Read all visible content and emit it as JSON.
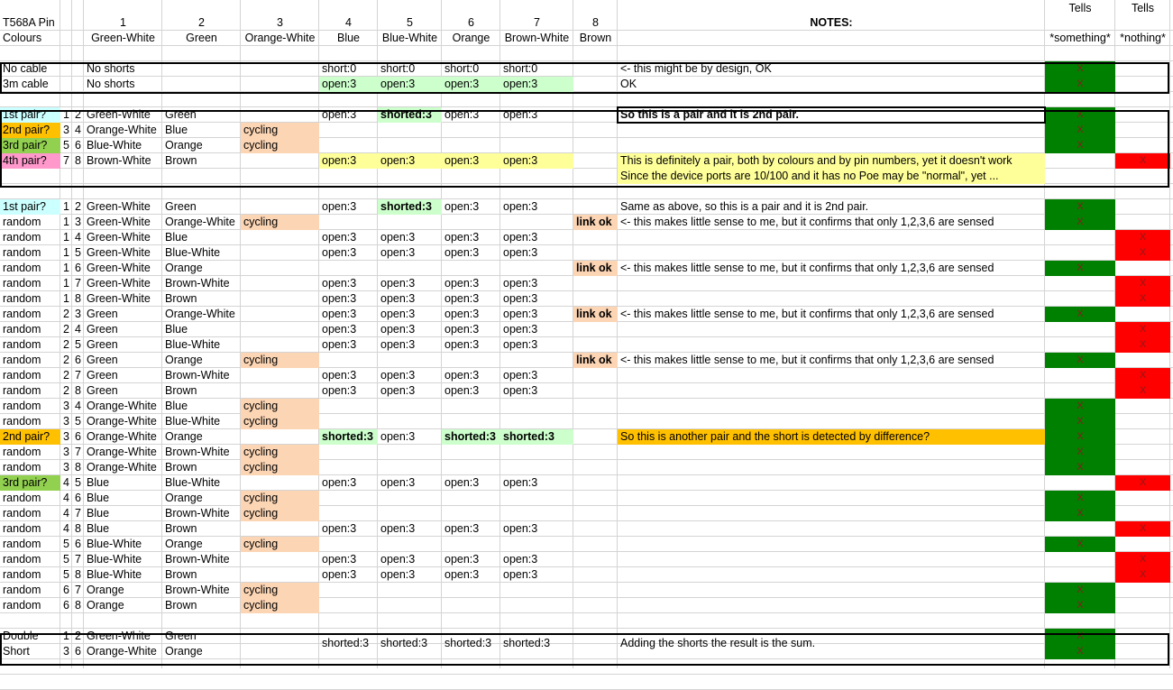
{
  "colors": {
    "light_blue": "#ccffff",
    "orange": "#ffc000",
    "green_yellow": "#92d050",
    "pink": "#ff99cc",
    "peach": "#fcd5b4",
    "light_green": "#ccffcc",
    "light_yellow": "#ffff99",
    "dark_green": "#008000",
    "red": "#ff0000",
    "grid": "#d4d4d4"
  },
  "header": {
    "row1": {
      "a": "T568A Pin",
      "d": "1",
      "e": "2",
      "f": "3",
      "g": "4",
      "h": "5",
      "i": "6",
      "j": "7",
      "k": "8",
      "l": "NOTES:",
      "m": "Tells",
      "n": "Tells"
    },
    "row2": {
      "a": "Colours",
      "d": "Green-White",
      "e": "Green",
      "f": "Orange-White",
      "g": "Blue",
      "h": "Blue-White",
      "i": "Orange",
      "j": "Brown-White",
      "k": "Brown",
      "m": "*something*",
      "n": "*nothing*"
    }
  },
  "rows": [
    {
      "r": 4,
      "a": "No cable",
      "d": "No shorts",
      "g": "short:0",
      "h": "short:0",
      "i": "short:0",
      "j": "short:0",
      "l": "<- this might be by design, OK",
      "m": "X",
      "mfill": "dark_green"
    },
    {
      "r": 5,
      "a": "3m cable",
      "d": "No shorts",
      "g": "open:3",
      "h": "open:3",
      "i": "open:3",
      "j": "open:3",
      "gfill": "light_green",
      "hfill": "light_green",
      "ifill": "light_green",
      "jfill": "light_green",
      "l": "OK",
      "m": "X",
      "mfill": "dark_green"
    },
    {
      "r": 7,
      "a": "1st pair?",
      "afill": "light_blue",
      "b": "1",
      "c": "2",
      "d": "Green-White",
      "e": "Green",
      "g": "open:3",
      "h": "shorted:3",
      "hbold": true,
      "hfill": "light_green",
      "i": "open:3",
      "j": "open:3",
      "l": "So this is a pair and it is 2nd pair.",
      "lbold": true,
      "m": "X",
      "mfill": "dark_green"
    },
    {
      "r": 8,
      "a": "2nd pair?",
      "afill": "orange",
      "b": "3",
      "c": "4",
      "d": "Orange-White",
      "e": "Blue",
      "f": "cycling",
      "ffill": "peach",
      "m": "X",
      "mfill": "dark_green"
    },
    {
      "r": 9,
      "a": "3rd pair?",
      "afill": "green_yellow",
      "b": "5",
      "c": "6",
      "d": "Blue-White",
      "e": "Orange",
      "f": "cycling",
      "ffill": "peach",
      "m": "X",
      "mfill": "dark_green"
    },
    {
      "r": 10,
      "a": "4th pair?",
      "afill": "pink",
      "b": "7",
      "c": "8",
      "d": "Brown-White",
      "e": "Brown",
      "g": "open:3",
      "h": "open:3",
      "i": "open:3",
      "j": "open:3",
      "gfill": "light_yellow",
      "hfill": "light_yellow",
      "ifill": "light_yellow",
      "jfill": "light_yellow",
      "l": "This is definitely a pair, both by colours and by pin numbers, yet it doesn't work",
      "lfill": "light_yellow",
      "n": "X",
      "nfill": "red"
    },
    {
      "r": 11,
      "l": "Since the device ports are 10/100 and it has no Poe may be \"normal\", yet ...",
      "lfill": "light_yellow"
    },
    {
      "r": 13,
      "a": "1st pair?",
      "afill": "light_blue",
      "b": "1",
      "c": "2",
      "d": "Green-White",
      "e": "Green",
      "g": "open:3",
      "h": "shorted:3",
      "hbold": true,
      "hfill": "light_green",
      "i": "open:3",
      "j": "open:3",
      "l": "Same as above, so this is a pair and it is 2nd pair.",
      "m": "X",
      "mfill": "dark_green"
    },
    {
      "r": 14,
      "a": "random",
      "b": "1",
      "c": "3",
      "d": "Green-White",
      "e": "Orange-White",
      "f": "cycling",
      "ffill": "peach",
      "k": "link ok",
      "kbold": true,
      "kfill": "peach",
      "l": "<- this makes little sense to me, but it confirms that only 1,2,3,6 are sensed",
      "m": "X",
      "mfill": "dark_green"
    },
    {
      "r": 15,
      "a": "random",
      "b": "1",
      "c": "4",
      "d": "Green-White",
      "e": "Blue",
      "g": "open:3",
      "h": "open:3",
      "i": "open:3",
      "j": "open:3",
      "n": "X",
      "nfill": "red"
    },
    {
      "r": 16,
      "a": "random",
      "b": "1",
      "c": "5",
      "d": "Green-White",
      "e": "Blue-White",
      "g": "open:3",
      "h": "open:3",
      "i": "open:3",
      "j": "open:3",
      "n": "X",
      "nfill": "red"
    },
    {
      "r": 17,
      "a": "random",
      "b": "1",
      "c": "6",
      "d": "Green-White",
      "e": "Orange",
      "k": "link ok",
      "kbold": true,
      "kfill": "peach",
      "l": "<- this makes little sense to me, but it confirms that only 1,2,3,6 are sensed",
      "m": "X",
      "mfill": "dark_green"
    },
    {
      "r": 18,
      "a": "random",
      "b": "1",
      "c": "7",
      "d": "Green-White",
      "e": "Brown-White",
      "g": "open:3",
      "h": "open:3",
      "i": "open:3",
      "j": "open:3",
      "n": "X",
      "nfill": "red"
    },
    {
      "r": 19,
      "a": "random",
      "b": "1",
      "c": "8",
      "d": "Green-White",
      "e": "Brown",
      "g": "open:3",
      "h": "open:3",
      "i": "open:3",
      "j": "open:3",
      "n": "X",
      "nfill": "red"
    },
    {
      "r": 20,
      "a": "random",
      "b": "2",
      "c": "3",
      "d": "Green",
      "e": "Orange-White",
      "g": "open:3",
      "h": "open:3",
      "i": "open:3",
      "j": "open:3",
      "k": "link ok",
      "kbold": true,
      "kfill": "peach",
      "l": "<- this makes little sense to me, but it confirms that only 1,2,3,6 are sensed",
      "m": "X",
      "mfill": "dark_green"
    },
    {
      "r": 21,
      "a": "random",
      "b": "2",
      "c": "4",
      "d": "Green",
      "e": "Blue",
      "g": "open:3",
      "h": "open:3",
      "i": "open:3",
      "j": "open:3",
      "n": "X",
      "nfill": "red"
    },
    {
      "r": 22,
      "a": "random",
      "b": "2",
      "c": "5",
      "d": "Green",
      "e": "Blue-White",
      "g": "open:3",
      "h": "open:3",
      "i": "open:3",
      "j": "open:3",
      "n": "X",
      "nfill": "red"
    },
    {
      "r": 23,
      "a": "random",
      "b": "2",
      "c": "6",
      "d": "Green",
      "e": "Orange",
      "f": "cycling",
      "ffill": "peach",
      "k": "link ok",
      "kbold": true,
      "kfill": "peach",
      "l": "<- this makes little sense to me, but it confirms that only 1,2,3,6 are sensed",
      "m": "X",
      "mfill": "dark_green"
    },
    {
      "r": 24,
      "a": "random",
      "b": "2",
      "c": "7",
      "d": "Green",
      "e": "Brown-White",
      "g": "open:3",
      "h": "open:3",
      "i": "open:3",
      "j": "open:3",
      "n": "X",
      "nfill": "red"
    },
    {
      "r": 25,
      "a": "random",
      "b": "2",
      "c": "8",
      "d": "Green",
      "e": "Brown",
      "g": "open:3",
      "h": "open:3",
      "i": "open:3",
      "j": "open:3",
      "n": "X",
      "nfill": "red"
    },
    {
      "r": 26,
      "a": "random",
      "b": "3",
      "c": "4",
      "d": "Orange-White",
      "e": "Blue",
      "f": "cycling",
      "ffill": "peach",
      "m": "X",
      "mfill": "dark_green"
    },
    {
      "r": 27,
      "a": "random",
      "b": "3",
      "c": "5",
      "d": "Orange-White",
      "e": "Blue-White",
      "f": "cycling",
      "ffill": "peach",
      "m": "X",
      "mfill": "dark_green"
    },
    {
      "r": 28,
      "a": "2nd pair?",
      "afill": "orange",
      "b": "3",
      "c": "6",
      "d": "Orange-White",
      "e": "Orange",
      "g": "shorted:3",
      "gbold": true,
      "gfill": "light_green",
      "h": "open:3",
      "i": "shorted:3",
      "ibold": true,
      "ifill": "light_green",
      "j": "shorted:3",
      "jbold": true,
      "jfill": "light_green",
      "l": "So this is another pair and the short is detected by difference?",
      "lfill": "orange",
      "m": "X",
      "mfill": "dark_green"
    },
    {
      "r": 29,
      "a": "random",
      "b": "3",
      "c": "7",
      "d": "Orange-White",
      "e": "Brown-White",
      "f": "cycling",
      "ffill": "peach",
      "m": "X",
      "mfill": "dark_green"
    },
    {
      "r": 30,
      "a": "random",
      "b": "3",
      "c": "8",
      "d": "Orange-White",
      "e": "Brown",
      "f": "cycling",
      "ffill": "peach",
      "m": "X",
      "mfill": "dark_green"
    },
    {
      "r": 31,
      "a": "3rd pair?",
      "afill": "green_yellow",
      "b": "4",
      "c": "5",
      "d": "Blue",
      "e": "Blue-White",
      "g": "open:3",
      "h": "open:3",
      "i": "open:3",
      "j": "open:3",
      "n": "X",
      "nfill": "red"
    },
    {
      "r": 32,
      "a": "random",
      "b": "4",
      "c": "6",
      "d": "Blue",
      "e": "Orange",
      "f": "cycling",
      "ffill": "peach",
      "m": "X",
      "mfill": "dark_green"
    },
    {
      "r": 33,
      "a": "random",
      "b": "4",
      "c": "7",
      "d": "Blue",
      "e": "Brown-White",
      "f": "cycling",
      "ffill": "peach",
      "m": "X",
      "mfill": "dark_green"
    },
    {
      "r": 34,
      "a": "random",
      "b": "4",
      "c": "8",
      "d": "Blue",
      "e": "Brown",
      "g": "open:3",
      "h": "open:3",
      "i": "open:3",
      "j": "open:3",
      "n": "X",
      "nfill": "red"
    },
    {
      "r": 35,
      "a": "random",
      "b": "5",
      "c": "6",
      "d": "Blue-White",
      "e": "Orange",
      "f": "cycling",
      "ffill": "peach",
      "m": "X",
      "mfill": "dark_green"
    },
    {
      "r": 36,
      "a": "random",
      "b": "5",
      "c": "7",
      "d": "Blue-White",
      "e": "Brown-White",
      "g": "open:3",
      "h": "open:3",
      "i": "open:3",
      "j": "open:3",
      "n": "X",
      "nfill": "red"
    },
    {
      "r": 37,
      "a": "random",
      "b": "5",
      "c": "8",
      "d": "Blue-White",
      "e": "Brown",
      "g": "open:3",
      "h": "open:3",
      "i": "open:3",
      "j": "open:3",
      "n": "X",
      "nfill": "red"
    },
    {
      "r": 38,
      "a": "random",
      "b": "6",
      "c": "7",
      "d": "Orange",
      "e": "Brown-White",
      "f": "cycling",
      "ffill": "peach",
      "m": "X",
      "mfill": "dark_green"
    },
    {
      "r": 39,
      "a": "random",
      "b": "6",
      "c": "8",
      "d": "Orange",
      "e": "Brown",
      "f": "cycling",
      "ffill": "peach",
      "m": "X",
      "mfill": "dark_green"
    },
    {
      "r": 41,
      "a": "Double",
      "b": "1",
      "c": "2",
      "d": "Green-White",
      "e": "Green",
      "m": "X",
      "mfill": "dark_green"
    },
    {
      "r": 42,
      "a": "Short",
      "b": "3",
      "c": "6",
      "d": "Orange-White",
      "e": "Orange",
      "m": "X",
      "mfill": "dark_green"
    }
  ],
  "merged": {
    "g": "shorted:3",
    "h": "shorted:3",
    "i": "shorted:3",
    "j": "shorted:3",
    "l": "Adding the shorts the result is the sum."
  }
}
